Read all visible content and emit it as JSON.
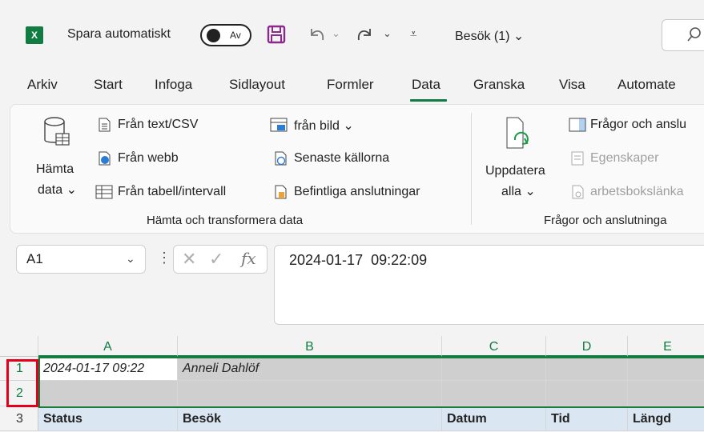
{
  "titlebar": {
    "excel_logo": "X",
    "autosave_label": "Spara automatiskt",
    "toggle_text": "Av",
    "doc_title": "Besök (1) ⌄",
    "icons": [
      "save-icon",
      "undo-icon",
      "redo-icon",
      "customize-qat-icon",
      "search-icon"
    ]
  },
  "tabs": [
    "Arkiv",
    "Start",
    "Infoga",
    "Sidlayout",
    "Formler",
    "Data",
    "Granska",
    "Visa",
    "Automate"
  ],
  "active_tab": "Data",
  "ribbon": {
    "get_data": {
      "line1": "Hämta",
      "line2": "data ⌄"
    },
    "from_text_csv": "Från text/CSV",
    "from_web": "Från webb",
    "from_table": "Från tabell/intervall",
    "from_picture": "från bild ⌄",
    "recent_sources": "Senaste källorna",
    "existing_connections": "Befintliga anslutningar",
    "group1_label": "Hämta och transformera data",
    "refresh_all": {
      "line1": "Uppdatera",
      "line2": "alla ⌄"
    },
    "queries_connections": "Frågor och anslu",
    "properties": "Egenskaper",
    "workbook_links": "arbetsbokslänka",
    "group2_label": "Frågor och anslutninga"
  },
  "formula_bar": {
    "name_box": "A1",
    "formula": "2024-01-17  09:22:09"
  },
  "grid": {
    "columns": [
      "A",
      "B",
      "C",
      "D",
      "E"
    ],
    "rows": [
      {
        "num": "1",
        "cells": [
          "2024-01-17 09:22",
          "Anneli Dahlöf",
          "",
          "",
          ""
        ]
      },
      {
        "num": "2",
        "cells": [
          "",
          "",
          "",
          "",
          ""
        ]
      },
      {
        "num": "3",
        "cells": [
          "Status",
          "Besök",
          "Datum",
          "Tid",
          "Längd"
        ]
      }
    ]
  },
  "colors": {
    "accent": "#107c41",
    "highlight": "#e3001b"
  }
}
